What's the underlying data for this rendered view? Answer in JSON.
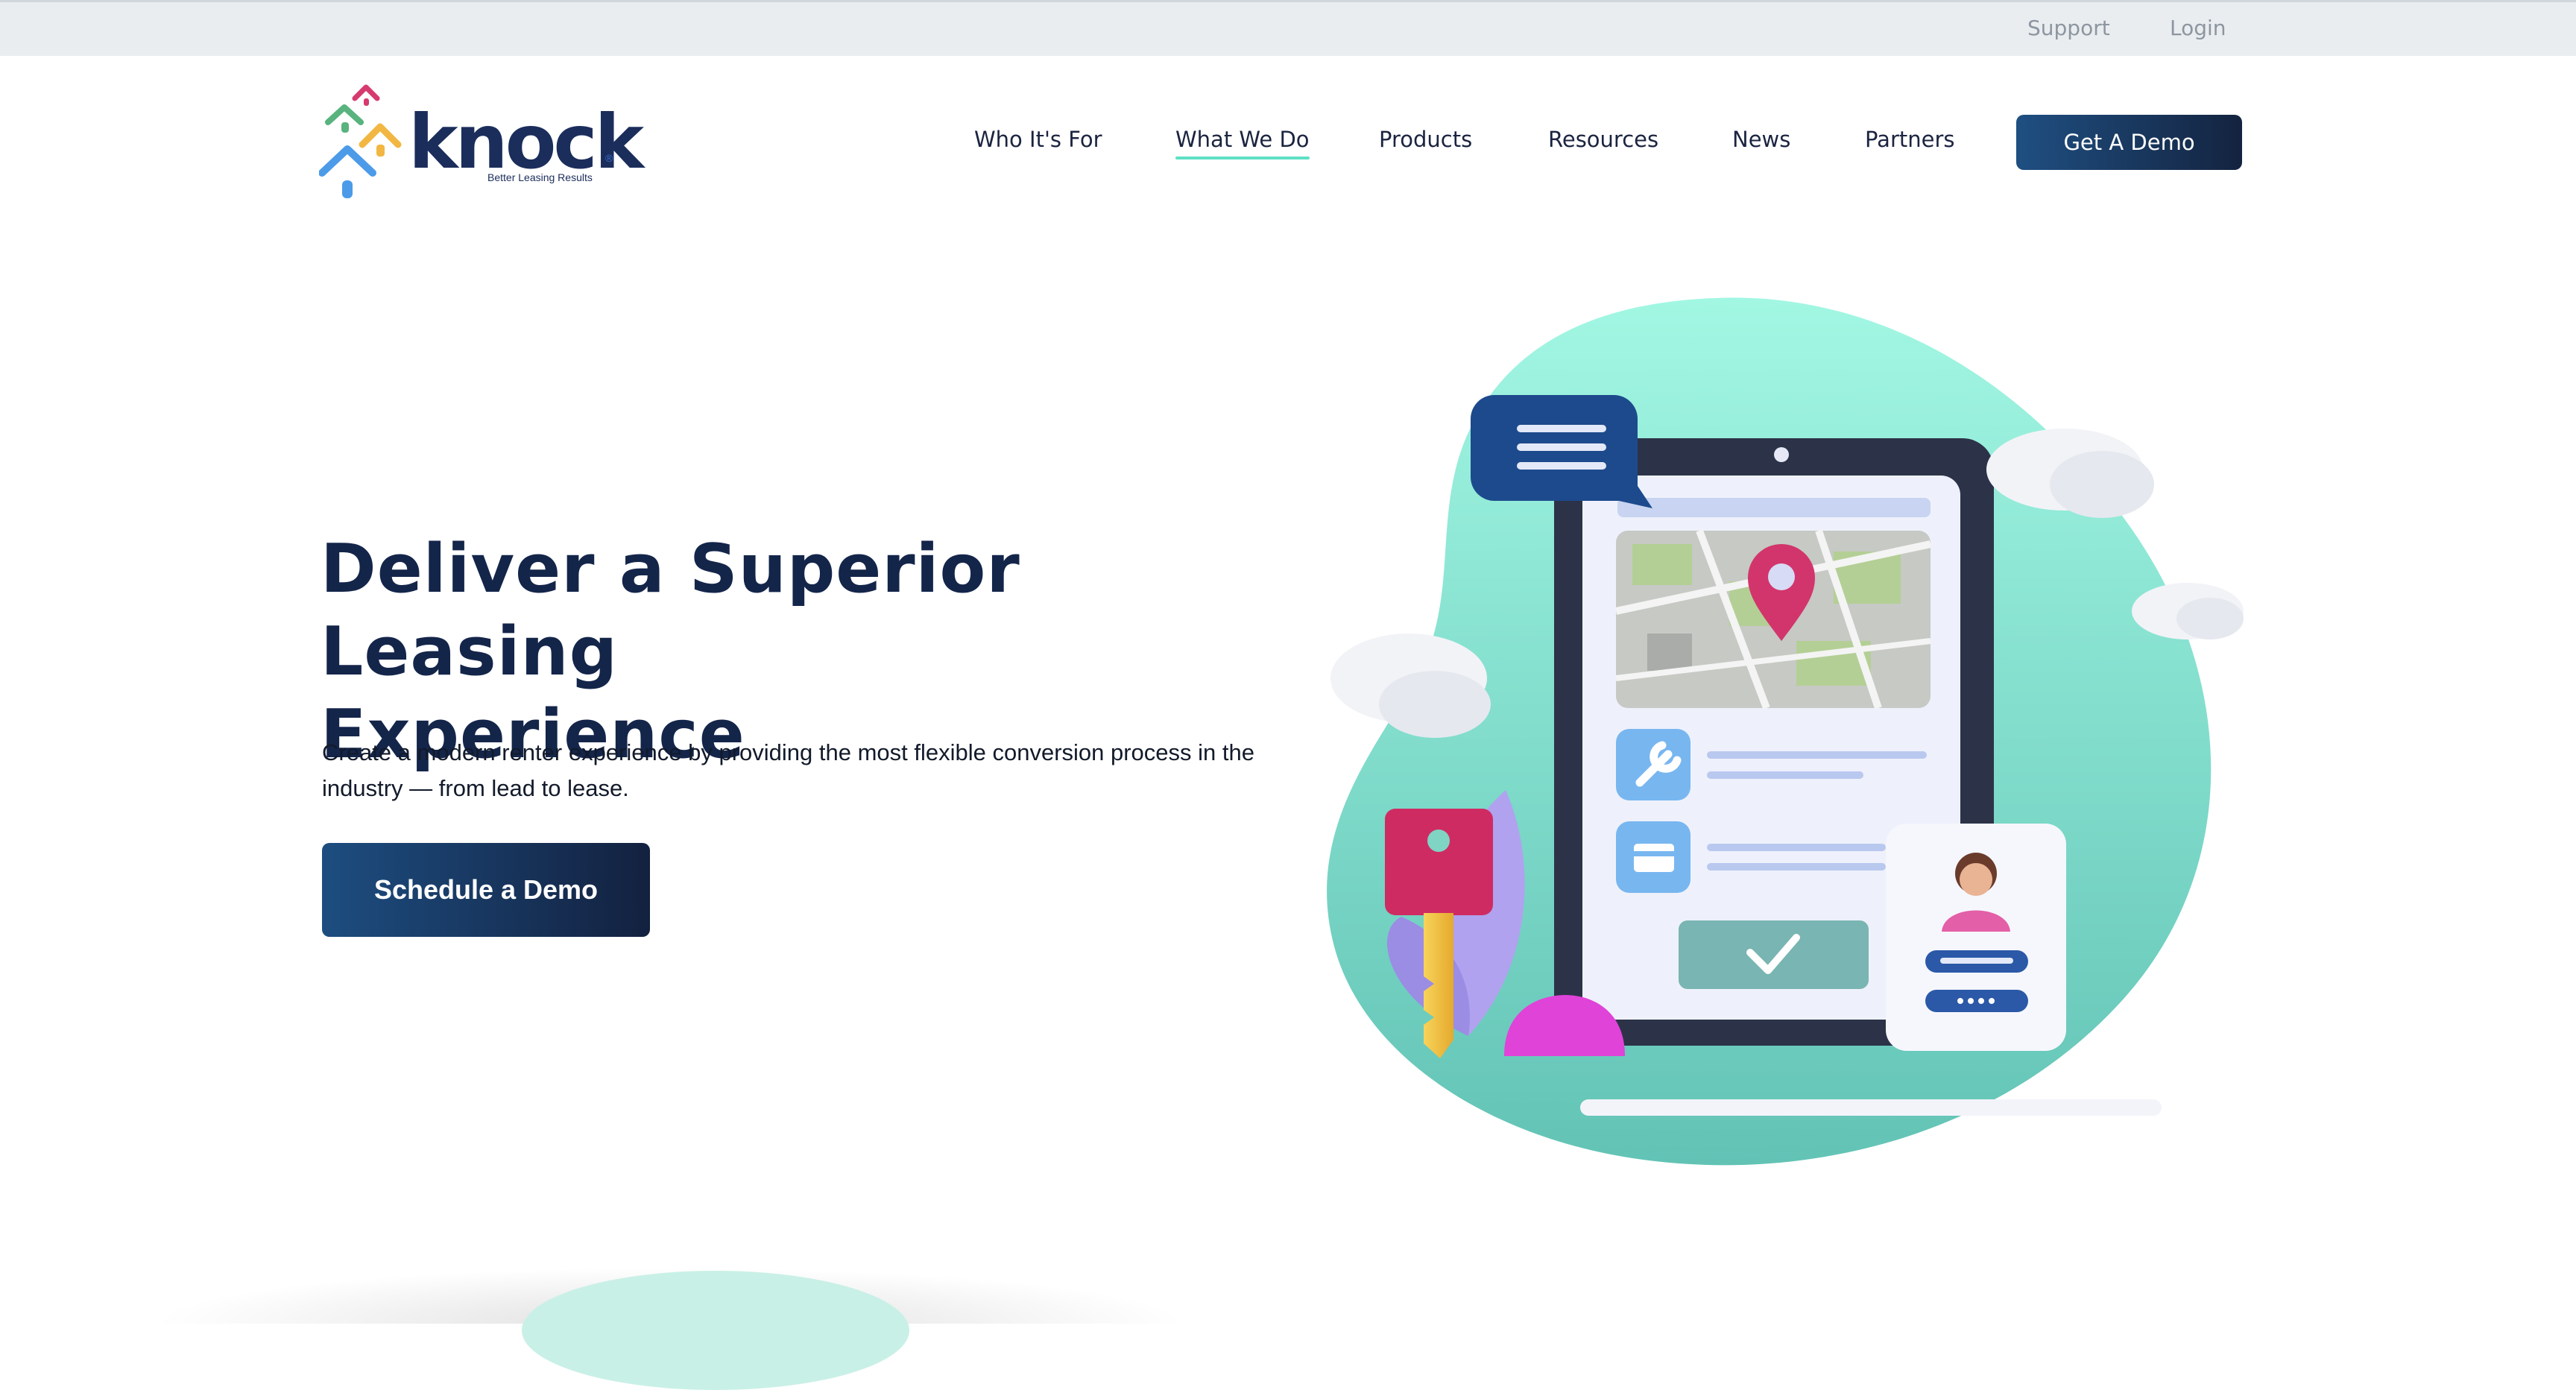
{
  "utility_bar": {
    "support": "Support",
    "login": "Login"
  },
  "logo": {
    "wordmark": "knock",
    "tagline": "Better Leasing Results",
    "registered": "®"
  },
  "nav": {
    "items": [
      {
        "label": "Who It's For"
      },
      {
        "label": "What We Do",
        "active": true
      },
      {
        "label": "Products"
      },
      {
        "label": "Resources"
      },
      {
        "label": "News"
      },
      {
        "label": "Partners"
      }
    ],
    "cta": "Get A Demo"
  },
  "hero": {
    "headline_line1": "Deliver a Superior Leasing",
    "headline_line2": "Experience",
    "subcopy": "Create a modern renter experience by providing the most flexible conversion process in the industry — from lead to lease.",
    "cta": "Schedule a Demo"
  },
  "colors": {
    "navy": "#14254a",
    "button_gradient_start": "#1d4d80",
    "button_gradient_end": "#13213f",
    "mint_accent": "#5fe0c6",
    "utility_bar_bg": "#e9edf0"
  },
  "illustration": {
    "icons": [
      "chat-bubble-icon",
      "map-pin-icon",
      "wrench-icon",
      "credit-card-icon",
      "checkmark-icon",
      "key-icon",
      "profile-avatar-icon",
      "cloud-icon"
    ]
  }
}
